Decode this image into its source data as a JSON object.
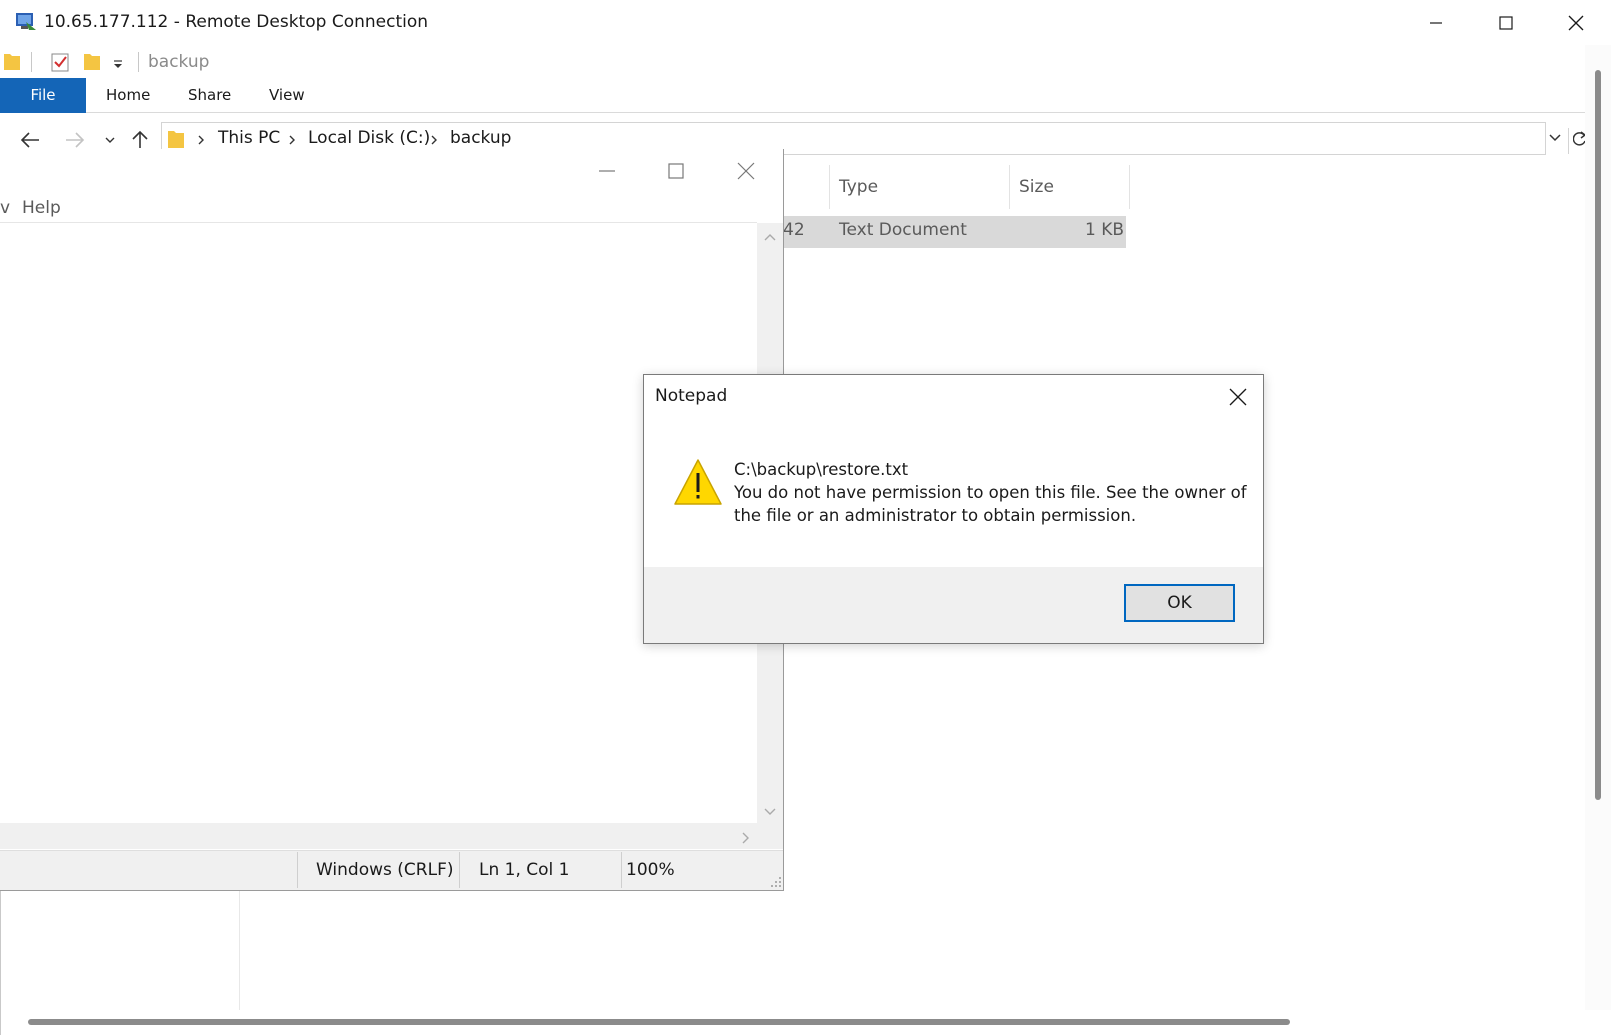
{
  "rdp": {
    "title": "10.65.177.112 - Remote Desktop Connection"
  },
  "explorer": {
    "qat_path": "backup",
    "ribbon_tabs": [
      "File",
      "Home",
      "Share",
      "View"
    ],
    "breadcrumbs": [
      "This PC",
      "Local Disk (C:)",
      "backup"
    ],
    "columns": [
      "Type",
      "Size"
    ],
    "file_row": {
      "date_fragment": "42",
      "type": "Text Document",
      "size": "1 KB"
    }
  },
  "notepad": {
    "menu_fragment": "v",
    "menu_help": "Help",
    "status": {
      "line_ending": "Windows (CRLF)",
      "position": "Ln 1, Col 1",
      "zoom": "100%"
    }
  },
  "dialog": {
    "title": "Notepad",
    "path": "C:\\backup\\restore.txt",
    "message_line1": "You do not have permission to open this file.  See the owner of",
    "message_line2": "the file or an administrator to obtain permission.",
    "ok_label": "OK"
  },
  "colors": {
    "accent": "#1465b7",
    "ok_border": "#0067c0",
    "warning_yellow": "#ffd700"
  }
}
